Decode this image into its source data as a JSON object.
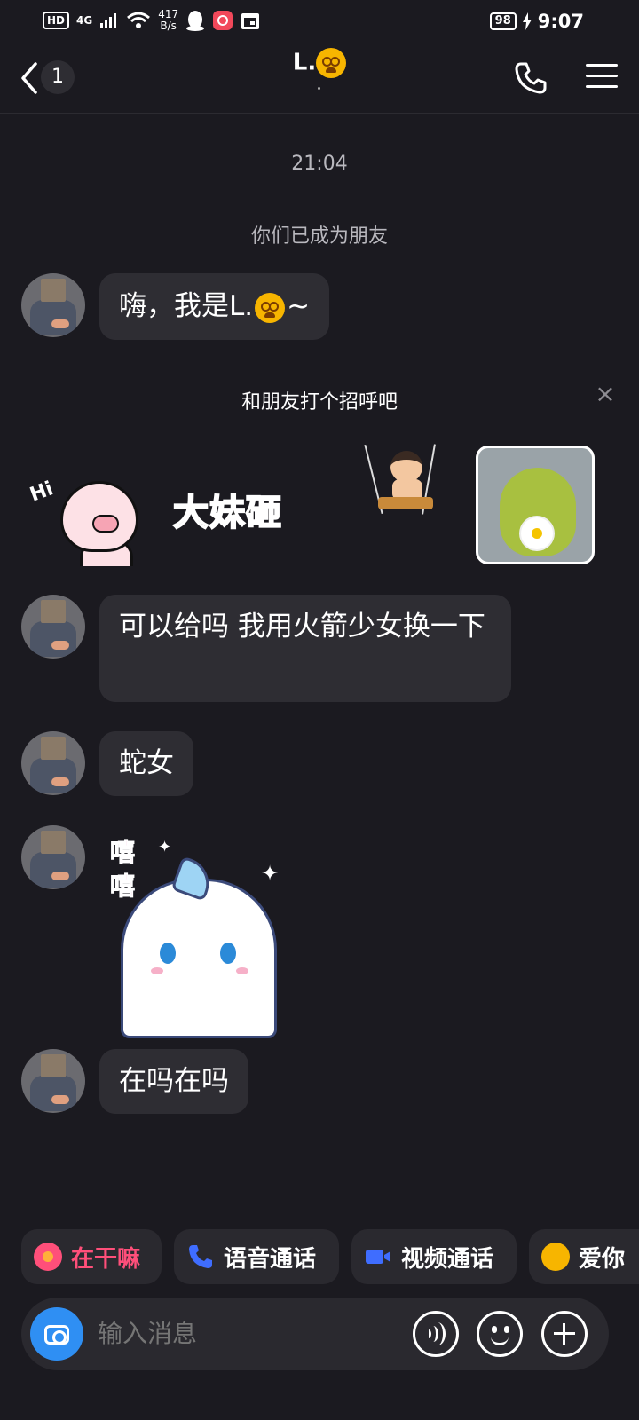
{
  "status_bar": {
    "hd": "HD",
    "network": "4G",
    "speed_value": "417",
    "speed_unit": "B/s",
    "battery": "98",
    "time": "9:07"
  },
  "header": {
    "unread_count": "1",
    "title": "L.",
    "subtitle": "."
  },
  "conversation": {
    "time_label": "21:04",
    "system_message": "你们已成为朋友",
    "greeting_prompt": "和朋友打个招呼吧",
    "greeting_close": "×",
    "messages": [
      {
        "type": "text",
        "text": "嗨，我是L.",
        "suffix": "~"
      },
      {
        "type": "text",
        "text": "可以给吗 我用火箭少女换一下"
      },
      {
        "type": "text",
        "text": "蛇女"
      },
      {
        "type": "sticker",
        "icon": "unicorn-cat-sticker",
        "text": "嘻嘻"
      },
      {
        "type": "text",
        "text": "在吗在吗"
      }
    ],
    "greeting_stickers": [
      {
        "name": "pig-hi-sticker",
        "text": "Hi"
      },
      {
        "name": "text-sticker",
        "text": "大妹砸"
      },
      {
        "name": "swing-boy-sticker"
      },
      {
        "name": "green-bear-photo-sticker"
      }
    ]
  },
  "quick_actions": [
    {
      "label": "在干嘛",
      "icon": "doing-icon",
      "color": "#ff4f7a"
    },
    {
      "label": "语音通话",
      "icon": "phone-icon",
      "color": "#3f6dff"
    },
    {
      "label": "视频通话",
      "icon": "video-icon",
      "color": "#3f6dff"
    },
    {
      "label": "爱你",
      "icon": "love-emoji-icon",
      "color": "#ffffff"
    }
  ],
  "input_bar": {
    "placeholder": "输入消息"
  },
  "colors": {
    "background": "#1b1a20",
    "bubble": "#2e2d33",
    "accent_blue": "#2f8ff3",
    "accent_pink": "#ff4f7a"
  }
}
